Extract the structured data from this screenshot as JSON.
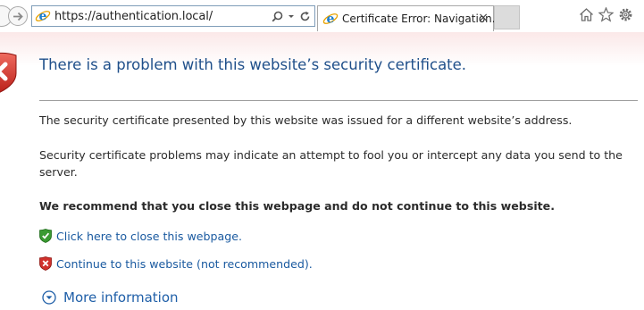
{
  "browser": {
    "address": {
      "url": "https://authentication.local/",
      "icons": [
        "search-icon",
        "dropdown-arrow-icon",
        "refresh-icon"
      ]
    },
    "tab": {
      "title": "Certificate Error: Navigation...",
      "close_label": "×"
    },
    "toolbar_icons": [
      "home-icon",
      "favorites-icon",
      "settings-icon"
    ]
  },
  "page": {
    "title": "There is a problem with this website’s security certificate.",
    "paragraph1": "The security certificate presented by this website was issued for a different website’s address.",
    "paragraph2": "Security certificate problems may indicate an attempt to fool you or intercept any data you send to the server.",
    "recommendation": "We recommend that you close this webpage and do not continue to this website.",
    "close_link": "Click here to close this webpage.",
    "continue_link": "Continue to this website (not recommended).",
    "more_info": "More information"
  },
  "colors": {
    "title": "#1f4f8a",
    "link": "#1a5aa0",
    "error_red": "#d0312d",
    "safe_green": "#3a9a32"
  }
}
